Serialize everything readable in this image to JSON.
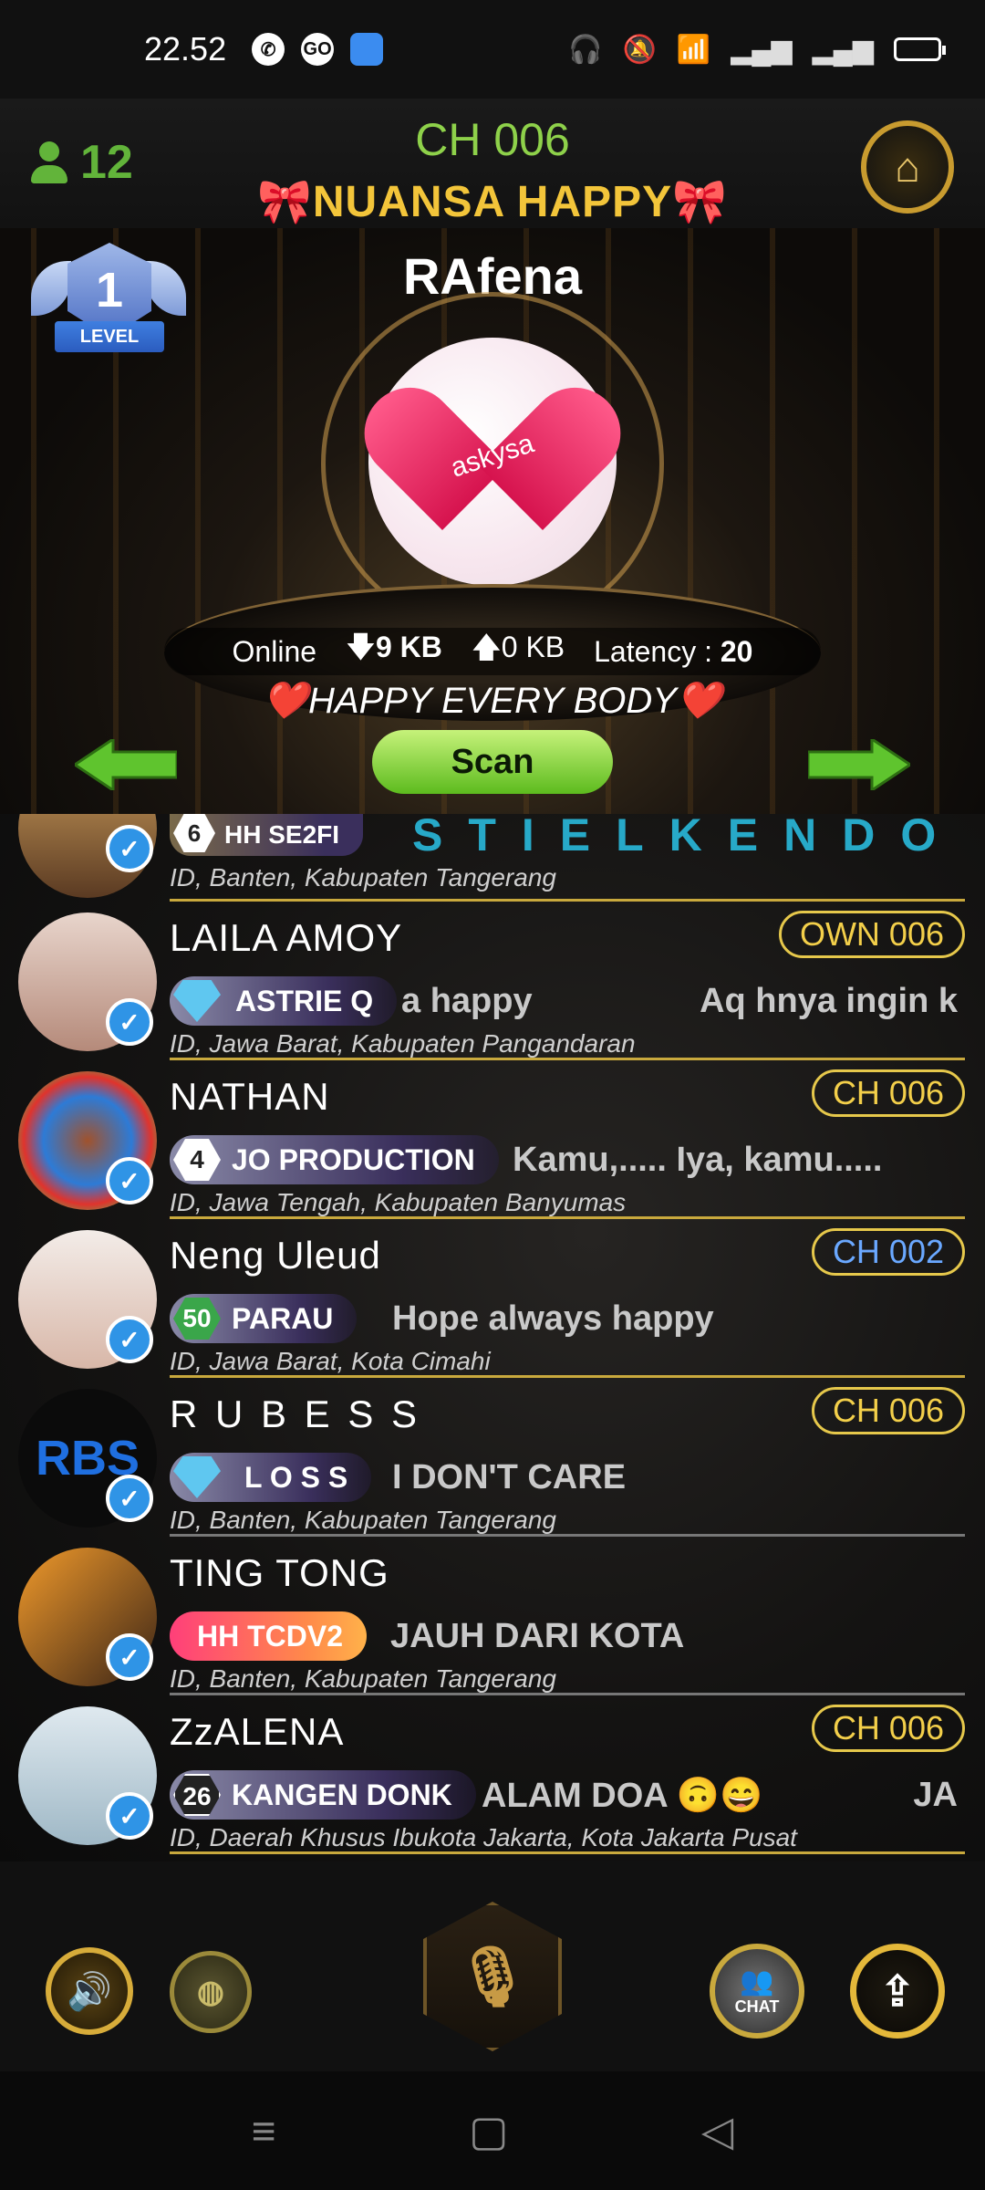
{
  "status_bar": {
    "time": "22.52",
    "notification_icons": [
      "whatsapp-icon",
      "go-icon",
      "app-icon"
    ],
    "right_icons": [
      "headphones-icon",
      "mute-icon",
      "wifi-icon",
      "signal-icon",
      "signal-icon",
      "battery-icon"
    ]
  },
  "header": {
    "user_count": "12",
    "channel": "CH 006",
    "room_name": "🎀NUANSA HAPPY🎀",
    "home_icon": "home-icon"
  },
  "stage": {
    "level_number": "1",
    "level_label": "LEVEL",
    "host_name": "RAfena",
    "host_avatar_text": "askysa",
    "stats": {
      "online_label": "Online",
      "down_arrow": "🡇",
      "down_value": "9 KB",
      "up_arrow": "🡅",
      "up_value": "0 KB",
      "latency_label": "Latency :",
      "latency_value": "20"
    },
    "motto": "❤️HAPPY EVERY BODY❤️",
    "scan_label": "Scan"
  },
  "list": {
    "top_row": {
      "level": "6",
      "badge": "HH  SE2FI",
      "status": "STIELKENDO",
      "location": "ID, Banten, Kabupaten Tangerang"
    },
    "rows": [
      {
        "name": "LAILA  AMOY",
        "channel": "OWN 006",
        "badge": "ASTRIE Q",
        "status": "a happy",
        "status_extra": "Aq hnya ingin k",
        "location": "ID, Jawa Barat, Kabupaten Pangandaran"
      },
      {
        "name": "NATHAN",
        "channel": "CH 006",
        "level": "4",
        "badge": "JO PRODUCTION",
        "status": "Kamu,..... Iya, kamu.....",
        "location": "ID, Jawa Tengah, Kabupaten Banyumas"
      },
      {
        "name": "Neng Uleud",
        "channel": "CH 002",
        "level": "50",
        "badge": "PARAU",
        "status": "Hope always happy",
        "location": "ID, Jawa Barat, Kota Cimahi"
      },
      {
        "name": "R U B E S S",
        "channel": "CH 006",
        "badge": "L O S S",
        "status": "I DON'T CARE",
        "location": "ID, Banten, Kabupaten Tangerang",
        "avatar_text": "RBS"
      },
      {
        "name": "TING TONG",
        "badge": "HH  TCDV2",
        "status": "JAUH DARI KOTA",
        "location": "ID, Banten, Kabupaten Tangerang"
      },
      {
        "name": "ZzALENA",
        "channel": "CH 006",
        "level": "26",
        "badge": "KANGEN DONK",
        "status": "ALAM DOA 🙃😄",
        "status_extra": "JA",
        "location": "ID, Daerah Khusus Ibukota Jakarta, Kota Jakarta Pusat"
      }
    ]
  },
  "bottom_bar": {
    "speaker_icon": "speaker-icon",
    "map_icon": "map-icon",
    "mic_icon": "microphone-icon",
    "chat_label": "CHAT",
    "upload_icon": "upload-icon"
  },
  "colors": {
    "accent_gold": "#e6c84b",
    "accent_green": "#62b43a",
    "verified_blue": "#2f94e6"
  }
}
